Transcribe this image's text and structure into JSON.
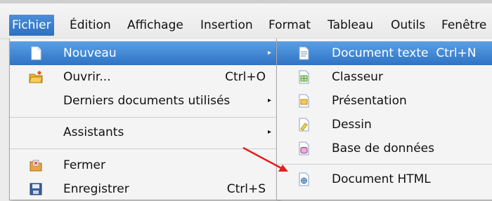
{
  "menubar": {
    "items": [
      {
        "label": "Fichier"
      },
      {
        "label": "Édition"
      },
      {
        "label": "Affichage"
      },
      {
        "label": "Insertion"
      },
      {
        "label": "Format"
      },
      {
        "label": "Tableau"
      },
      {
        "label": "Outils"
      },
      {
        "label": "Fenêtre"
      }
    ]
  },
  "file_menu": {
    "items": [
      {
        "label": "Nouveau",
        "icon": "new-document-icon",
        "submenu": true,
        "highlighted": true
      },
      {
        "label": "Ouvrir...",
        "shortcut": "Ctrl+O",
        "icon": "open-folder-icon"
      },
      {
        "label": "Derniers documents utilisés",
        "submenu": true
      },
      {
        "label": "Assistants",
        "submenu": true
      },
      {
        "label": "Fermer",
        "icon": "close-document-icon"
      },
      {
        "label": "Enregistrer",
        "shortcut": "Ctrl+S",
        "icon": "save-icon"
      }
    ]
  },
  "new_submenu": {
    "items": [
      {
        "label": "Document texte",
        "shortcut": "Ctrl+N",
        "icon": "text-document-icon",
        "highlighted": true
      },
      {
        "label": "Classeur",
        "icon": "spreadsheet-icon"
      },
      {
        "label": "Présentation",
        "icon": "presentation-icon"
      },
      {
        "label": "Dessin",
        "icon": "drawing-icon"
      },
      {
        "label": "Base de données",
        "icon": "database-icon"
      },
      {
        "label": "Document HTML",
        "icon": "html-document-icon"
      }
    ]
  },
  "colors": {
    "highlight": "#2f73c4",
    "annotation_arrow": "#e0201a"
  }
}
